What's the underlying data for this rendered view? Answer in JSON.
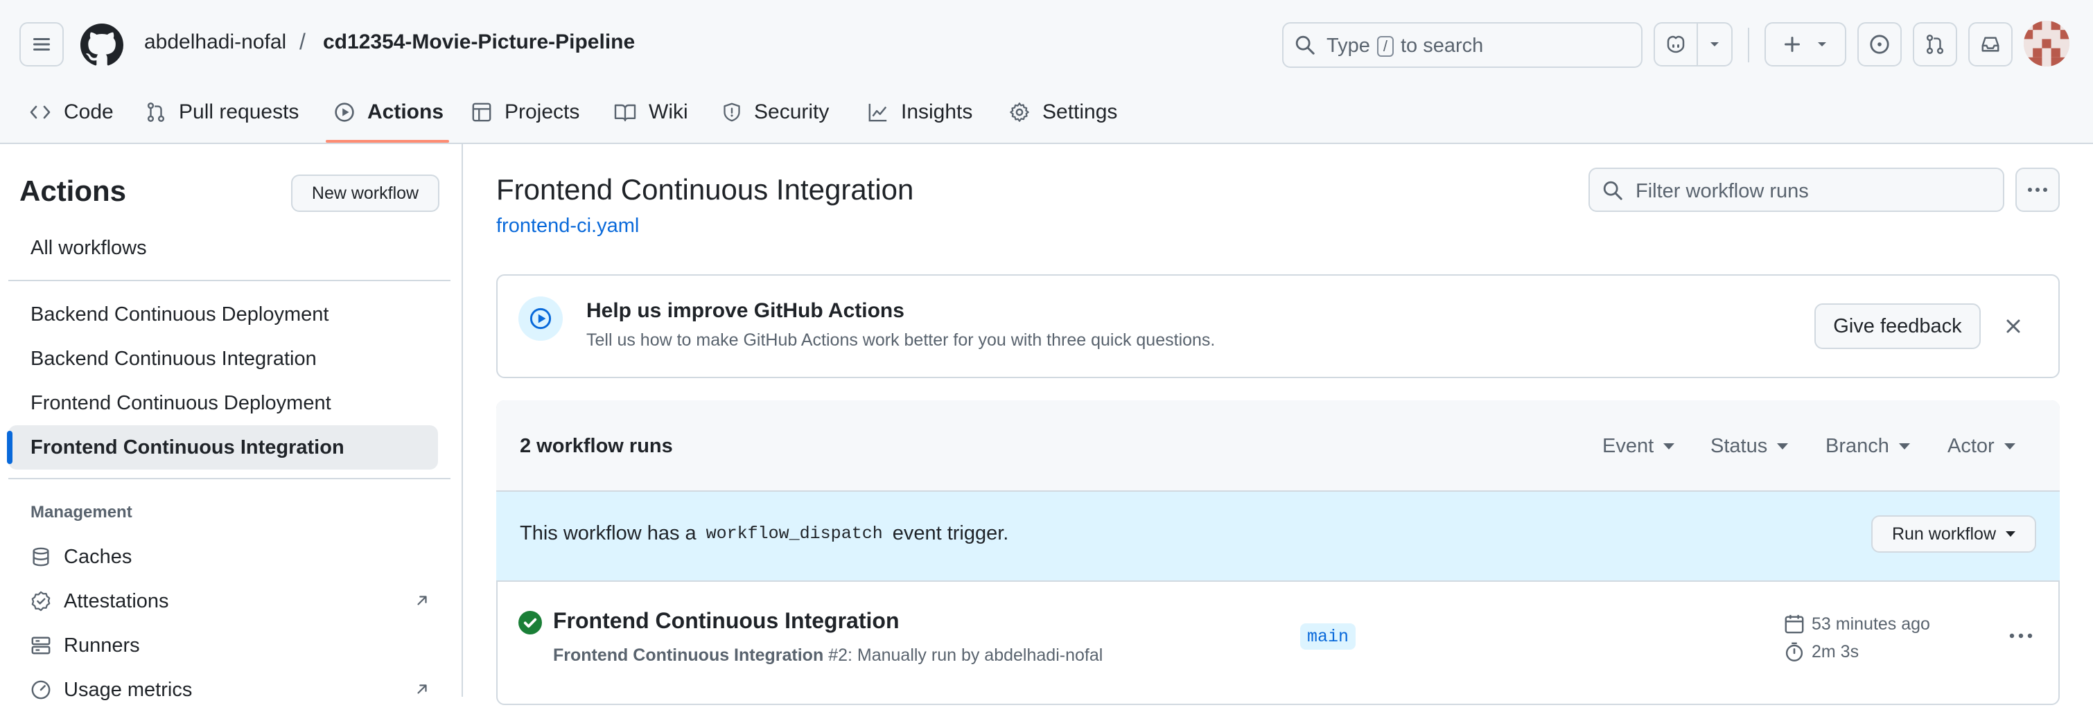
{
  "header": {
    "owner": "abdelhadi-nofal",
    "separator": "/",
    "repo": "cd12354-Movie-Picture-Pipeline",
    "search": {
      "before_key": "Type",
      "key": "/",
      "after_key": "to search"
    }
  },
  "tabs": [
    {
      "label": "Code",
      "icon": "code-icon"
    },
    {
      "label": "Pull requests",
      "icon": "pull-request-icon"
    },
    {
      "label": "Actions",
      "icon": "play-icon",
      "active": true
    },
    {
      "label": "Projects",
      "icon": "table-icon"
    },
    {
      "label": "Wiki",
      "icon": "book-icon"
    },
    {
      "label": "Security",
      "icon": "shield-icon"
    },
    {
      "label": "Insights",
      "icon": "graph-icon"
    },
    {
      "label": "Settings",
      "icon": "gear-icon"
    }
  ],
  "sidebar": {
    "title": "Actions",
    "new_workflow": "New workflow",
    "all_workflows": "All workflows",
    "workflows": [
      "Backend Continuous Deployment",
      "Backend Continuous Integration",
      "Frontend Continuous Deployment",
      "Frontend Continuous Integration"
    ],
    "selected_workflow": "Frontend Continuous Integration",
    "management_heading": "Management",
    "management": [
      {
        "label": "Caches",
        "icon": "database-icon"
      },
      {
        "label": "Attestations",
        "icon": "verified-icon"
      },
      {
        "label": "Runners",
        "icon": "server-icon"
      },
      {
        "label": "Usage metrics",
        "icon": "meter-icon"
      }
    ]
  },
  "main": {
    "title": "Frontend Continuous Integration",
    "file_link": "frontend-ci.yaml",
    "filter_placeholder": "Filter workflow runs",
    "banner": {
      "title": "Help us improve GitHub Actions",
      "subtitle": "Tell us how to make GitHub Actions work better for you with three quick questions.",
      "button": "Give feedback"
    },
    "runs": {
      "count_label": "2 workflow runs",
      "filters": [
        "Event",
        "Status",
        "Branch",
        "Actor"
      ],
      "dispatch": {
        "before": "This workflow has a",
        "code": "workflow_dispatch",
        "after": "event trigger."
      },
      "run_workflow_button": "Run workflow",
      "items": [
        {
          "title": "Frontend Continuous Integration",
          "workflow": "Frontend Continuous Integration",
          "detail": "#2: Manually run by abdelhadi-nofal",
          "branch": "main",
          "time_ago": "53 minutes ago",
          "duration": "2m 3s",
          "status": "success"
        }
      ]
    }
  },
  "colors": {
    "accent": "#0969da",
    "tab_underline": "#fd8c73",
    "success": "#1a7f37",
    "dispatch_bg": "#ddf4ff"
  }
}
